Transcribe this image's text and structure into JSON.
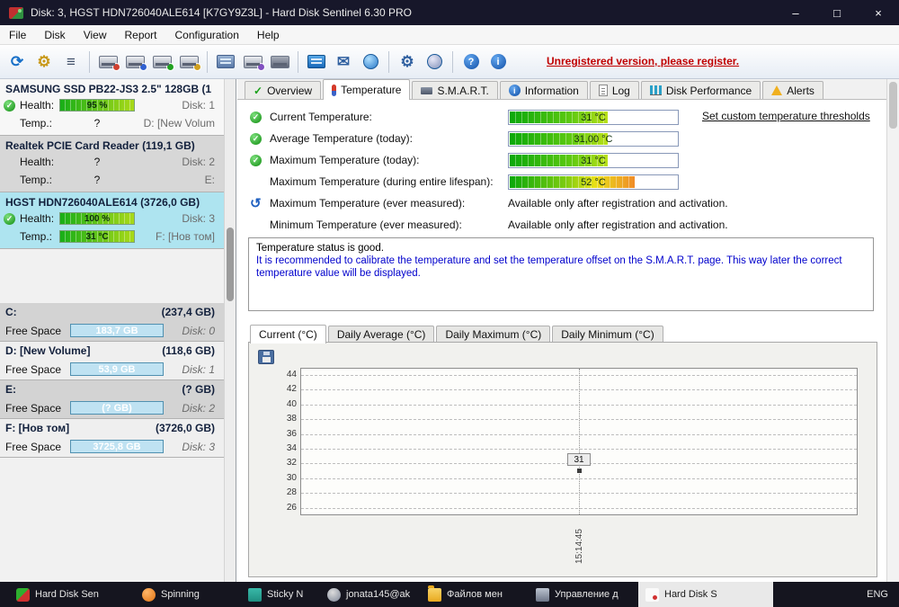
{
  "window": {
    "title": "Disk: 3, HGST HDN726040ALE614 [K7GY9Z3L]  -  Hard Disk Sentinel 6.30 PRO",
    "minimize": "–",
    "maximize": "□",
    "close": "×"
  },
  "icons": {
    "check": "✓",
    "back": "↺",
    "question": "?",
    "info": "i",
    "mail": "✉",
    "gear": "⚙",
    "refresh": "⟳",
    "lines": "≡",
    "down": "↓"
  },
  "menu": {
    "items": [
      "File",
      "Disk",
      "View",
      "Report",
      "Configuration",
      "Help"
    ]
  },
  "toolbar": {
    "register_notice": "Unregistered version, please register."
  },
  "sidebar": {
    "disks": [
      {
        "name": "SAMSUNG SSD PB22-JS3 2.5\" 128GB (1",
        "health_label": "Health:",
        "health": "95 %",
        "disk": "Disk: 1",
        "temp_label": "Temp.:",
        "temp": "?",
        "drive": "D: [New Volum"
      },
      {
        "name": "Realtek PCIE Card Reader (119,1 GB)",
        "health_label": "Health:",
        "health": "?",
        "disk": "Disk: 2",
        "temp_label": "Temp.:",
        "temp": "?",
        "drive": "E:"
      },
      {
        "name": "HGST HDN726040ALE614 (3726,0 GB)",
        "health_label": "Health:",
        "health": "100 %",
        "disk": "Disk: 3",
        "temp_label": "Temp.:",
        "temp": "31 °C",
        "drive": "F: [Нов том]"
      }
    ],
    "partitions": [
      {
        "name": "C:",
        "size": "(237,4 GB)",
        "free_label": "Free Space",
        "free": "183,7 GB",
        "disk": "Disk: 0"
      },
      {
        "name": "D: [New Volume]",
        "size": "(118,6 GB)",
        "free_label": "Free Space",
        "free": "53,9 GB",
        "disk": "Disk: 1"
      },
      {
        "name": "E:",
        "size": "(? GB)",
        "free_label": "Free Space",
        "free": "(? GB)",
        "disk": "Disk: 2"
      },
      {
        "name": "F: [Нов том]",
        "size": "(3726,0 GB)",
        "free_label": "Free Space",
        "free": "3725,8 GB",
        "disk": "Disk: 3"
      }
    ]
  },
  "tabs": {
    "items": [
      "Overview",
      "Temperature",
      "S.M.A.R.T.",
      "Information",
      "Log",
      "Disk Performance",
      "Alerts"
    ],
    "active": "Temperature"
  },
  "temperature_panel": {
    "rows": [
      {
        "label": "Current Temperature:",
        "value": "31 °C"
      },
      {
        "label": "Average Temperature (today):",
        "value": "31,00 °C"
      },
      {
        "label": "Maximum Temperature (today):",
        "value": "31 °C"
      },
      {
        "label": "Maximum Temperature (during entire lifespan):",
        "value": "52 °C"
      },
      {
        "label": "Maximum Temperature (ever measured):",
        "value": "Available only after registration and activation."
      },
      {
        "label": "Minimum Temperature (ever measured):",
        "value": "Available only after registration and activation."
      }
    ],
    "threshold_link": "Set custom temperature thresholds",
    "status_line1": "Temperature status is good.",
    "status_line2": "It is recommended to calibrate the temperature and set the temperature offset on the S.M.A.R.T. page. This way later the correct temperature value will be displayed."
  },
  "chart_data": {
    "type": "line",
    "tabs": [
      "Current (°C)",
      "Daily Average (°C)",
      "Daily Maximum (°C)",
      "Daily Minimum (°C)"
    ],
    "active_tab": "Current (°C)",
    "title": "Current (°C)",
    "xlabel": "",
    "ylabel": "°C",
    "ylim": [
      25,
      45
    ],
    "yticks": [
      44,
      42,
      40,
      38,
      36,
      34,
      32,
      30,
      28,
      26
    ],
    "x": [
      "15:14:45"
    ],
    "series": [
      {
        "name": "Current temperature",
        "values": [
          31
        ]
      }
    ],
    "point_label": "31",
    "grid": true,
    "legend": "none"
  },
  "taskbar": {
    "items": [
      "Hard Disk Sen",
      "Spinning",
      "Sticky N",
      "jonata145@ak",
      "Файлов мен",
      "Управление д",
      "Hard Disk S"
    ],
    "lang": "ENG"
  }
}
